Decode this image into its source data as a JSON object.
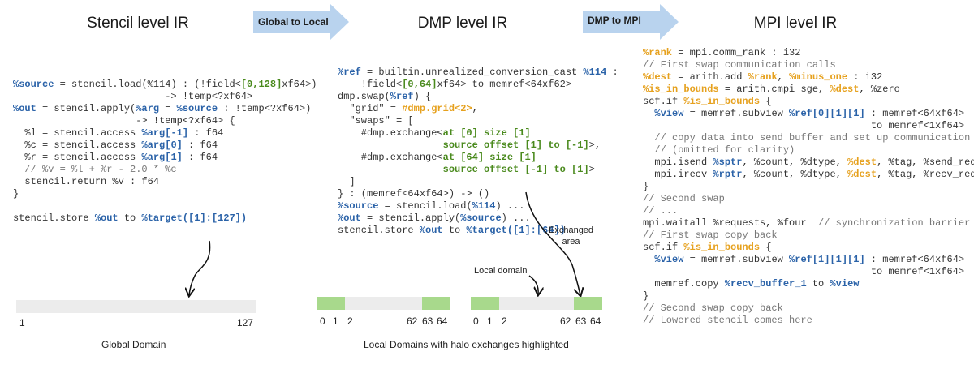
{
  "headings": {
    "stencil": "Stencil level IR",
    "dmp": "DMP level IR",
    "mpi": "MPI level IR"
  },
  "transforms": {
    "global_to_local": "Global to Local",
    "dmp_to_mpi": "DMP to MPI"
  },
  "stencil_code": [
    "%source = stencil.load(%114) : (!field<[0,128]xf64>)",
    "                          -> !temp<?xf64>",
    "%out = stencil.apply(%arg = %source : !temp<?xf64>)",
    "                     -> !temp<?xf64> {",
    "  %l = stencil.access %arg[-1] : f64",
    "  %c = stencil.access %arg[0] : f64",
    "  %r = stencil.access %arg[1] : f64",
    "  // %v = %l + %r - 2.0 * %c",
    "  stencil.return %v : f64",
    "}",
    "",
    "stencil.store %out to %target([1]:[127])"
  ],
  "dmp_code": [
    "%ref = builtin.unrealized_conversion_cast %114 :",
    "    !field<[0,64]xf64> to memref<64xf62>",
    "dmp.swap(%ref) {",
    "  \"grid\" = #dmp.grid<2>,",
    "  \"swaps\" = [",
    "    #dmp.exchange<at [0] size [1]",
    "                  source offset [1] to [-1]>,",
    "    #dmp.exchange<at [64] size [1]",
    "                  source offset [-1] to [1]>",
    "  ]",
    "} : (memref<64xf64>) -> ()",
    "%source = stencil.load(%114) ...",
    "%out = stencil.apply(%source) ...",
    "stencil.store %out to %target([1]:[64])"
  ],
  "mpi_code": [
    "%rank = mpi.comm_rank : i32",
    "// First swap communication calls",
    "%dest = arith.add %rank, %minus_one : i32",
    "%is_in_bounds = arith.cmpi sge, %dest, %zero",
    "scf.if %is_in_bounds {",
    "  %view = memref.subview %ref[0][1][1] : memref<64xf64>",
    "                                       to memref<1xf64>",
    "  // copy data into send buffer and set up communication",
    "  // (omitted for clarity)",
    "  mpi.isend %sptr, %count, %dtype, %dest, %tag, %send_req",
    "  mpi.irecv %rptr, %count, %dtype, %dest, %tag, %recv_req",
    "}",
    "// Second swap",
    "// ...",
    "mpi.waitall %requests, %four  // synchronization barrier",
    "// First swap copy back",
    "scf.if %is_in_bounds {",
    "  %view = memref.subview %ref[1][1][1] : memref<64xf64>",
    "                                       to memref<1xf64>",
    "  memref.copy %recv_buffer_1 to %view",
    "}",
    "// Second swap copy back",
    "// Lowered stencil comes here"
  ],
  "annotations": {
    "exchanged": "Exchanged\narea",
    "local_domain": "Local domain"
  },
  "global_domain": {
    "caption": "Global Domain",
    "tick_start": "1",
    "tick_end": "127"
  },
  "local_domains": {
    "caption": "Local Domains with halo exchanges highlighted",
    "ticks": [
      "0",
      "1",
      "2",
      "62",
      "63",
      "64"
    ]
  },
  "colors": {
    "arrow": "#b9d3ee",
    "halo": "#a8d98c",
    "bar": "#ececec",
    "variable": "#2a62a8",
    "mpi_variable": "#e6a11e",
    "dmp_value": "#4a8a1d"
  }
}
